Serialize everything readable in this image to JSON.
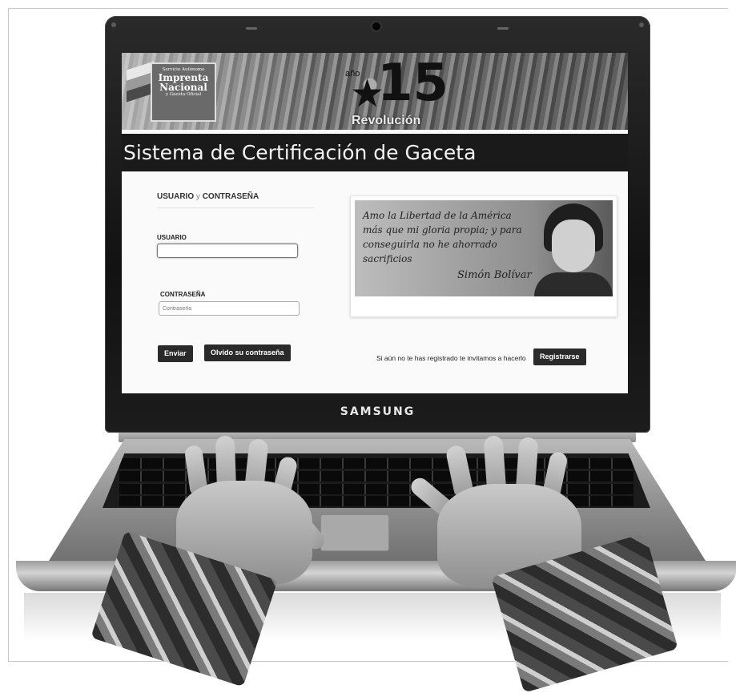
{
  "laptop": {
    "brand": "SAMSUNG"
  },
  "banner": {
    "logo_lines": [
      "Servicio Autónomo",
      "Imprenta",
      "Nacional",
      "y Gaceta Oficial"
    ],
    "emblem_small": "año",
    "emblem_number": "15",
    "emblem_caption": "Revolución"
  },
  "page": {
    "title": "Sistema de Certificación de Gaceta"
  },
  "login": {
    "header_user": "USUARIO",
    "header_sep": "y",
    "header_pass": "CONTRASEÑA",
    "user_label": "USUARIO",
    "user_value": "",
    "pass_label": "CONTRASEÑA",
    "pass_placeholder": "Contraseña",
    "submit_label": "Enviar",
    "forgot_label": "Olvido su contraseña"
  },
  "quote": {
    "text": "Amo la Libertad de la América más que mi gloria propia; y para conseguirla no he ahorrado sacrificios",
    "signature": "Simón Bolívar"
  },
  "register": {
    "prompt": "Si aún no te has registrado te invitamos a hacerlo",
    "button_label": "Registrarse"
  }
}
